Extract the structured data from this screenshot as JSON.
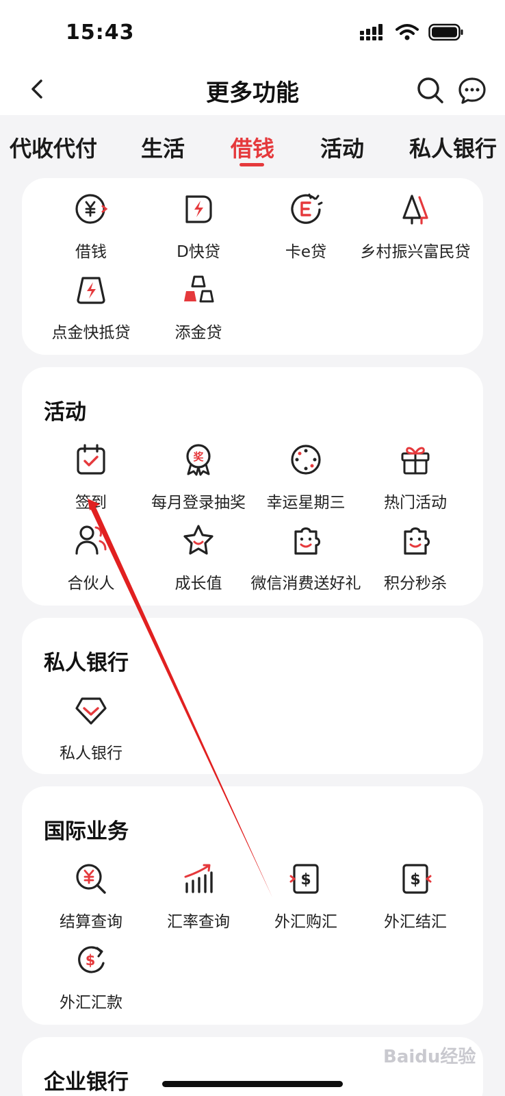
{
  "status": {
    "time": "15:43"
  },
  "nav": {
    "title": "更多功能"
  },
  "tabs": [
    {
      "label": "代收代付"
    },
    {
      "label": "生活"
    },
    {
      "label": "借钱",
      "active": true
    },
    {
      "label": "活动"
    },
    {
      "label": "私人银行"
    }
  ],
  "loan": {
    "items": [
      {
        "label": "借钱",
        "icon": "yen-arrow-icon"
      },
      {
        "label": "D快贷",
        "icon": "lightning-shield-icon"
      },
      {
        "label": "卡e贷",
        "icon": "e-circle-icon"
      },
      {
        "label": "乡村振兴富民贷",
        "icon": "tree-icon"
      },
      {
        "label": "点金快抵贷",
        "icon": "lightning-gold-icon"
      },
      {
        "label": "添金贷",
        "icon": "gold-bars-icon"
      }
    ]
  },
  "activity": {
    "title": "活动",
    "items": [
      {
        "label": "签到",
        "icon": "calendar-check-icon"
      },
      {
        "label": "每月登录抽奖",
        "icon": "medal-prize-icon"
      },
      {
        "label": "幸运星期三",
        "icon": "clock-dots-icon"
      },
      {
        "label": "热门活动",
        "icon": "gift-icon"
      },
      {
        "label": "合伙人",
        "icon": "partner-icon"
      },
      {
        "label": "成长值",
        "icon": "star-icon"
      },
      {
        "label": "微信消费送好礼",
        "icon": "puzzle-smile-icon"
      },
      {
        "label": "积分秒杀",
        "icon": "puzzle-smile-icon"
      }
    ]
  },
  "private_bank": {
    "title": "私人银行",
    "items": [
      {
        "label": "私人银行",
        "icon": "diamond-icon"
      }
    ]
  },
  "international": {
    "title": "国际业务",
    "items": [
      {
        "label": "结算查询",
        "icon": "yen-search-icon"
      },
      {
        "label": "汇率查询",
        "icon": "chart-up-icon"
      },
      {
        "label": "外汇购汇",
        "icon": "dollar-box-in-icon"
      },
      {
        "label": "外汇结汇",
        "icon": "dollar-box-out-icon"
      },
      {
        "label": "外汇汇款",
        "icon": "dollar-cycle-icon"
      }
    ]
  },
  "enterprise": {
    "title": "企业银行"
  },
  "watermark": "Baidu经验",
  "colors": {
    "accent": "#e5393c",
    "text": "#222222",
    "background": "#f4f4f6",
    "card": "#ffffff"
  }
}
